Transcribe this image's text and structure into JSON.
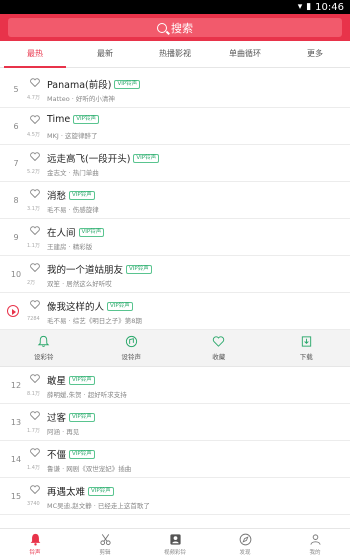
{
  "status_bar": {
    "time": "10:46"
  },
  "search": {
    "label": "搜索"
  },
  "tabs": [
    "最热",
    "最新",
    "热播影视",
    "单曲循环",
    "更多"
  ],
  "songs": [
    {
      "rank": "5",
      "plays": "4.7万",
      "title": "Panama(前段)",
      "vip": "VIP铃声",
      "subtitle": "Matteo · 好听的小清神"
    },
    {
      "rank": "6",
      "plays": "4.5万",
      "title": "Time",
      "vip": "VIP铃声",
      "subtitle": "MKJ · 这旋律醉了"
    },
    {
      "rank": "7",
      "plays": "5.2万",
      "title": "远走高飞(一段开头)",
      "vip": "VIP铃声",
      "subtitle": "金志文 · 热门单曲"
    },
    {
      "rank": "8",
      "plays": "3.1万",
      "title": "消愁",
      "vip": "VIP铃声",
      "subtitle": "毛不易 · 伤感旋律"
    },
    {
      "rank": "9",
      "plays": "1.1万",
      "title": "在人间",
      "vip": "VIP铃声",
      "subtitle": "王建房 · 精彩版"
    },
    {
      "rank": "10",
      "plays": "2万",
      "title": "我的一个道姑朋友",
      "vip": "VIP铃声",
      "subtitle": "双笙 · 居然这么好听哎"
    },
    {
      "rank": "",
      "plays": "7284",
      "title": "像我这样的人",
      "vip": "VIP铃声",
      "subtitle": "毛不易 · 综艺《明日之子》第8期",
      "playing": true
    },
    {
      "rank": "12",
      "plays": "8.1万",
      "title": "敢星",
      "vip": "VIP铃声",
      "subtitle": "薛明媛,朱贺 · 超好听求支持"
    },
    {
      "rank": "13",
      "plays": "1.7万",
      "title": "过客",
      "vip": "VIP铃声",
      "subtitle": "阿涵 · 再见"
    },
    {
      "rank": "14",
      "plays": "1.4万",
      "title": "不僵",
      "vip": "VIP铃声",
      "subtitle": "鲁谦 · 网剧《双世宠妃》插曲"
    },
    {
      "rank": "15",
      "plays": "3740",
      "title": "再遇太难",
      "vip": "VIP铃声",
      "subtitle": "MC吴迪,赵文静 · 已经走上这首歌了"
    }
  ],
  "actions": [
    {
      "label": "设彩铃",
      "icon": "bell-icon"
    },
    {
      "label": "设铃声",
      "icon": "ring-icon"
    },
    {
      "label": "收藏",
      "icon": "heart-icon"
    },
    {
      "label": "下载",
      "icon": "download-icon"
    }
  ],
  "nav": [
    {
      "label": "铃声",
      "icon": "bell-icon"
    },
    {
      "label": "剪辑",
      "icon": "scissors-icon"
    },
    {
      "label": "视频彩铃",
      "icon": "video-icon"
    },
    {
      "label": "发现",
      "icon": "compass-icon"
    },
    {
      "label": "我的",
      "icon": "user-icon"
    }
  ],
  "colors": {
    "accent": "#e8334a",
    "vip": "#2aa86b"
  }
}
